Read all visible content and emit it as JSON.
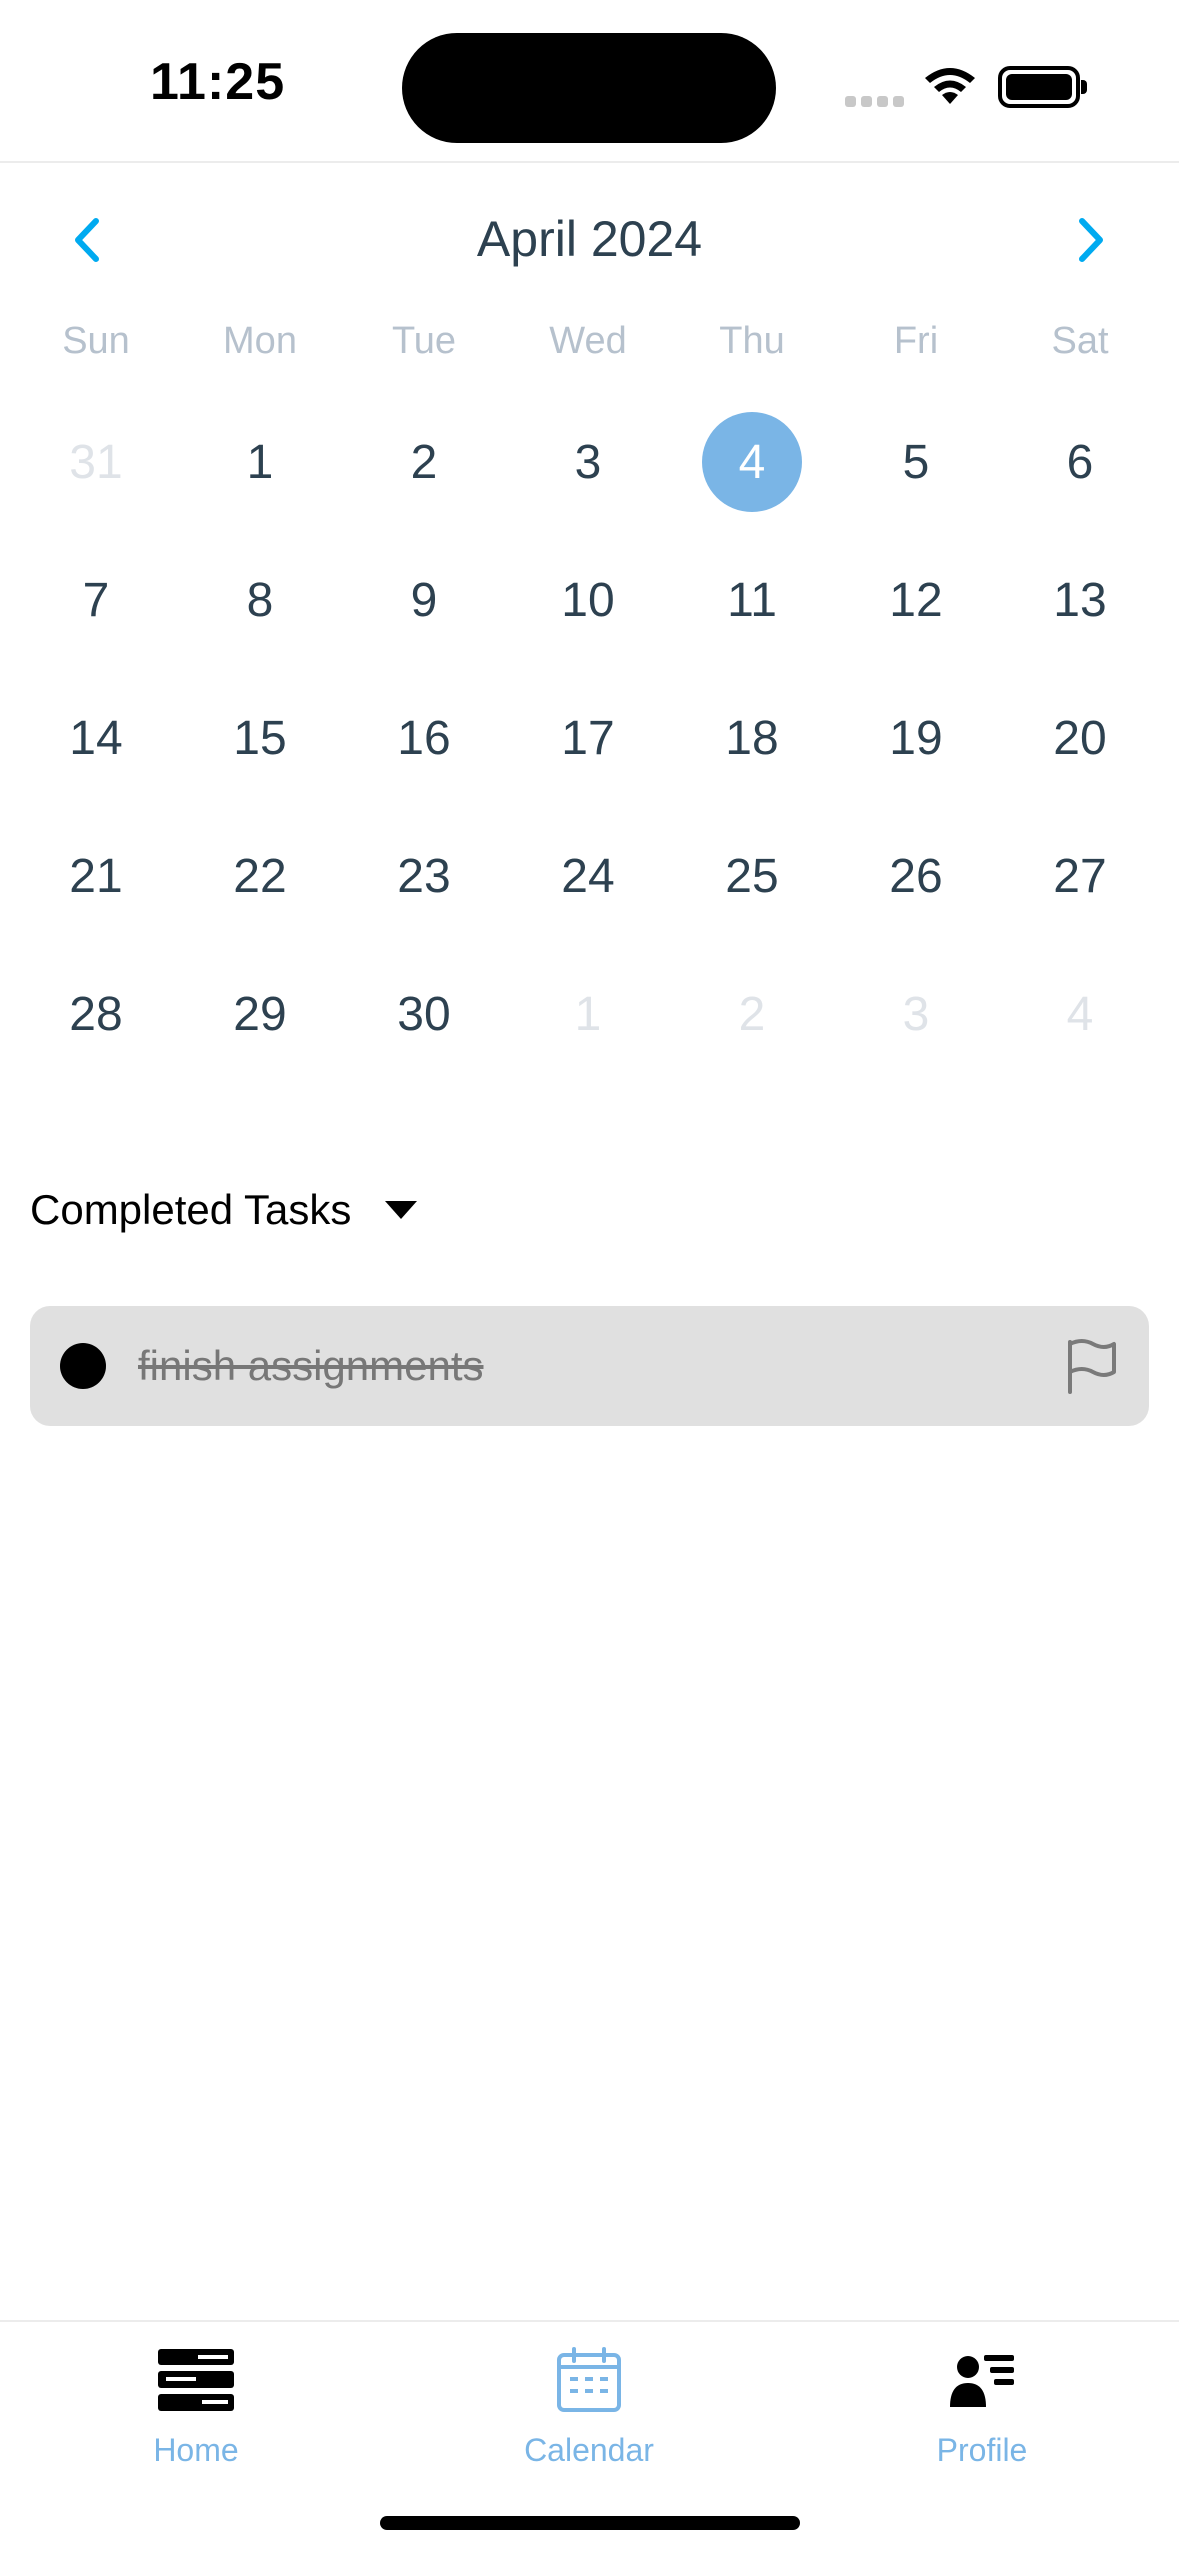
{
  "status_bar": {
    "time": "11:25"
  },
  "calendar": {
    "month_title": "April 2024",
    "accent_color": "#00aaf0",
    "selected_color": "#7ab5e6",
    "weekdays": [
      "Sun",
      "Mon",
      "Tue",
      "Wed",
      "Thu",
      "Fri",
      "Sat"
    ],
    "weeks": [
      [
        "31",
        "1",
        "2",
        "3",
        "4",
        "5",
        "6"
      ],
      [
        "7",
        "8",
        "9",
        "10",
        "11",
        "12",
        "13"
      ],
      [
        "14",
        "15",
        "16",
        "17",
        "18",
        "19",
        "20"
      ],
      [
        "21",
        "22",
        "23",
        "24",
        "25",
        "26",
        "27"
      ],
      [
        "28",
        "29",
        "30",
        "1",
        "2",
        "3",
        "4"
      ]
    ],
    "selected_day": "4"
  },
  "completed_section": {
    "title": "Completed Tasks"
  },
  "tasks": [
    {
      "text": "finish assignments",
      "completed": true,
      "icon": "flag-icon"
    }
  ],
  "tab_bar": {
    "tabs": [
      {
        "label": "Home",
        "icon": "home-icon"
      },
      {
        "label": "Calendar",
        "icon": "calendar-icon"
      },
      {
        "label": "Profile",
        "icon": "profile-icon"
      }
    ]
  }
}
